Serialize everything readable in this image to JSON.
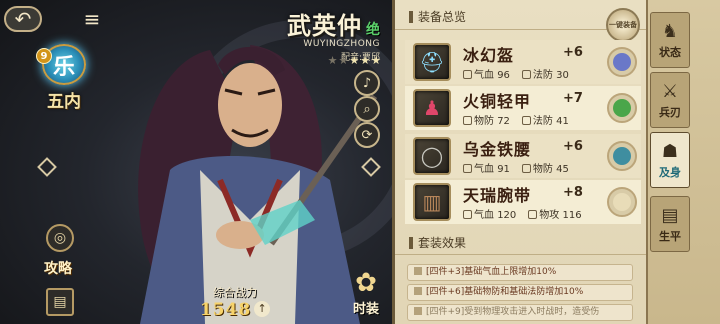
{
  "hero": {
    "name": "武英仲",
    "rarity": "绝",
    "pinyin": "WUYINGZHONG",
    "voice_actor": "配音:贾邱",
    "stars_filled": "★★★",
    "stars_empty": "★★",
    "faction_level": "9",
    "faction_name": "五内",
    "power_label": "综合战力",
    "power_value": "1548",
    "fashion_label": "时装"
  },
  "left_panel": {
    "guide_label": "攻略",
    "back_icon": "back-arrow-icon",
    "menu_icon": "menu-icon"
  },
  "sheet": {
    "title": "装备总览",
    "corner_button": "一键装备",
    "set_title": "套装效果",
    "equipment": [
      {
        "name": "冰幻盔",
        "level": "+6",
        "stat1_label": "气血",
        "stat1_value": "96",
        "stat2_label": "法防",
        "stat2_value": "30",
        "gem_color": "#6a78c8"
      },
      {
        "name": "火铜轻甲",
        "level": "+7",
        "stat1_label": "物防",
        "stat1_value": "72",
        "stat2_label": "法防",
        "stat2_value": "41",
        "gem_color": "#4aa64a"
      },
      {
        "name": "乌金铁腰",
        "level": "+6",
        "stat1_label": "气血",
        "stat1_value": "91",
        "stat2_label": "物防",
        "stat2_value": "45",
        "gem_color": "#3f8ea0"
      },
      {
        "name": "天瑞腕带",
        "level": "+8",
        "stat1_label": "气血",
        "stat1_value": "120",
        "stat2_label": "物攻",
        "stat2_value": "116",
        "gem_color": "#e8dcb8"
      }
    ],
    "set_effects": [
      "[四件+3]基础气血上限增加10%",
      "[四件+6]基础物防和基础法防增加10%",
      "[四件+9]受到物理攻击进入时战时，造受伤"
    ]
  },
  "tabs": [
    {
      "label": "状态",
      "icon": "status-icon"
    },
    {
      "label": "兵刃",
      "icon": "weapon-icon"
    },
    {
      "label": "及身",
      "icon": "armor-icon"
    },
    {
      "label": "生平",
      "icon": "biography-icon"
    }
  ]
}
